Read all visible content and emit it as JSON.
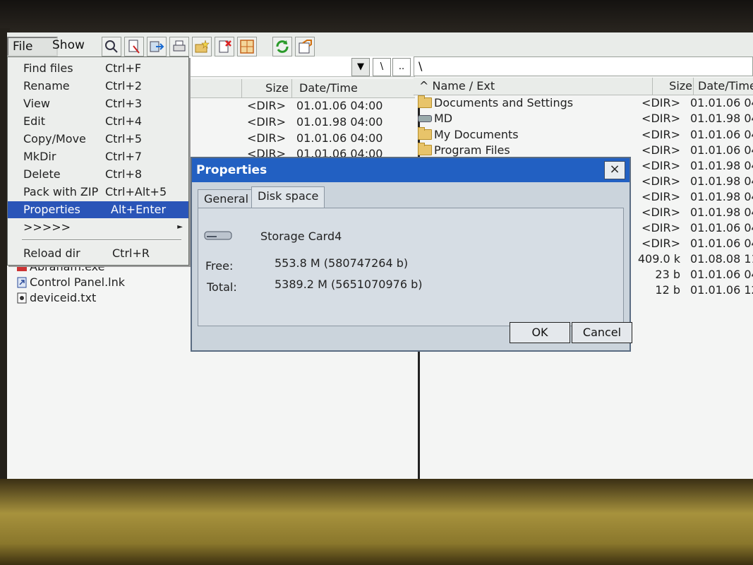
{
  "menubar": {
    "file": "File",
    "show": "Show"
  },
  "toolbar_icons": [
    "find-icon",
    "find-next-icon",
    "copy-icon",
    "print-icon",
    "new-folder-icon",
    "delete-icon",
    "grid-icon",
    "refresh-icon",
    "properties-icon"
  ],
  "file_menu": [
    {
      "label": "Find files",
      "shortcut": "Ctrl+F"
    },
    {
      "label": "Rename",
      "shortcut": "Ctrl+2"
    },
    {
      "label": "View",
      "shortcut": "Ctrl+3"
    },
    {
      "label": "Edit",
      "shortcut": "Ctrl+4"
    },
    {
      "label": "Copy/Move",
      "shortcut": "Ctrl+5"
    },
    {
      "label": "MkDir",
      "shortcut": "Ctrl+7"
    },
    {
      "label": "Delete",
      "shortcut": "Ctrl+8"
    },
    {
      "label": "Pack with ZIP",
      "shortcut": "Ctrl+Alt+5"
    },
    {
      "label": "Properties",
      "shortcut": "Alt+Enter"
    },
    {
      "label": ">>>>>",
      "shortcut": ""
    },
    {
      "label": "Reload dir",
      "shortcut": "Ctrl+R"
    }
  ],
  "left_panel": {
    "path_buttons": [
      "\\",
      ".."
    ],
    "headers": {
      "size": "Size",
      "date": "Date/Time"
    },
    "rows": [
      {
        "size": "<DIR>",
        "date": "01.01.06 04:00"
      },
      {
        "size": "<DIR>",
        "date": "01.01.98 04:00"
      },
      {
        "size": "<DIR>",
        "date": "01.01.06 04:00"
      },
      {
        "size": "<DIR>",
        "date": "01.01.06 04:00"
      }
    ],
    "files": [
      "Abraham.exe",
      "Control Panel.lnk",
      "deviceid.txt"
    ]
  },
  "right_panel": {
    "path": "\\",
    "headers": {
      "name": "^ Name / Ext",
      "size": "Size",
      "date": "Date/Time"
    },
    "rows": [
      {
        "name": "Documents and Settings",
        "icon": "folder-icon",
        "size": "<DIR>",
        "date": "01.01.06 04"
      },
      {
        "name": "MD",
        "icon": "drive-icon",
        "size": "<DIR>",
        "date": "01.01.98 04"
      },
      {
        "name": "My Documents",
        "icon": "folder-icon",
        "size": "<DIR>",
        "date": "01.01.06 04"
      },
      {
        "name": "Program Files",
        "icon": "folder-icon",
        "size": "<DIR>",
        "date": "01.01.06 04"
      },
      {
        "name": "",
        "icon": "",
        "size": "<DIR>",
        "date": "01.01.98 04"
      },
      {
        "name": "",
        "icon": "",
        "size": "<DIR>",
        "date": "01.01.98 04"
      },
      {
        "name": "",
        "icon": "",
        "size": "<DIR>",
        "date": "01.01.98 04"
      },
      {
        "name": "",
        "icon": "",
        "size": "<DIR>",
        "date": "01.01.98 04"
      },
      {
        "name": "",
        "icon": "",
        "size": "<DIR>",
        "date": "01.01.06 04"
      },
      {
        "name": "",
        "icon": "",
        "size": "<DIR>",
        "date": "01.01.06 04"
      },
      {
        "name": "",
        "icon": "",
        "size": "409.0 k",
        "date": "01.08.08 11"
      },
      {
        "name": "",
        "icon": "",
        "size": "23 b",
        "date": "01.01.06 04"
      },
      {
        "name": "",
        "icon": "",
        "size": "12 b",
        "date": "01.01.06 12"
      }
    ]
  },
  "dialog": {
    "title": "Properties",
    "close": "×",
    "tabs": [
      "General",
      "Disk space"
    ],
    "drive_name": "Storage Card4",
    "free_label": "Free:",
    "free_value": "553.8 M (580747264 b)",
    "total_label": "Total:",
    "total_value": "5389.2 M (5651070976 b)",
    "ok": "OK",
    "cancel": "Cancel"
  }
}
